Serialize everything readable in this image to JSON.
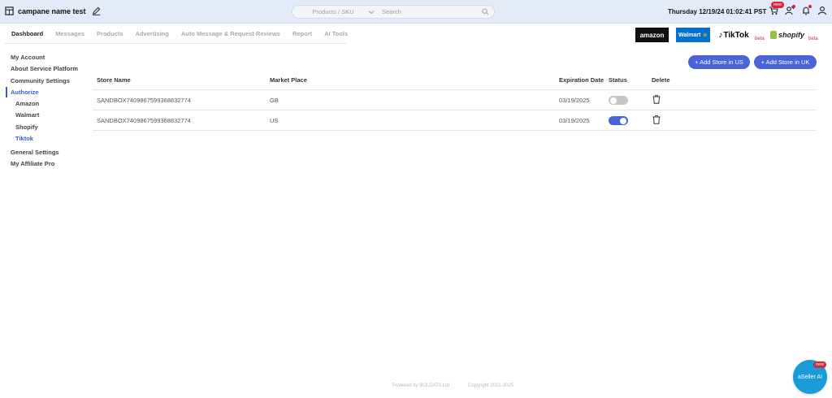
{
  "header": {
    "store_name": "campane name test",
    "search_select": "Products / SKU",
    "search_placeholder": "Search",
    "datetime": "Thursday 12/19/24 01:02:41 PST",
    "new_badge": "new"
  },
  "nav": {
    "tabs": [
      "Dashboard",
      "Messages",
      "Products",
      "Advertising",
      "Auto Message & Request Reviews",
      "Report",
      "AI Tools"
    ],
    "active": "Dashboard"
  },
  "marketplaces": {
    "amazon": "amazon",
    "walmart": "Walmart",
    "tiktok": "TikTok",
    "shopify": "shopify",
    "beta_label": "beta"
  },
  "sidebar": {
    "items": [
      {
        "label": "My Account"
      },
      {
        "label": "About Service Platform"
      },
      {
        "label": "Community Settings"
      },
      {
        "label": "Authorize"
      },
      {
        "label": "Amazon"
      },
      {
        "label": "Walmart"
      },
      {
        "label": "Shopify"
      },
      {
        "label": "Tiktok"
      },
      {
        "label": "General Settings"
      },
      {
        "label": "My Affiliate Pro"
      }
    ]
  },
  "actions": {
    "add_us": "+ Add Store in US",
    "add_uk": "+ Add Store in UK"
  },
  "table": {
    "headers": {
      "store": "Store Name",
      "market": "Market Place",
      "expiration": "Expiration Date",
      "status": "Status",
      "delete": "Delete"
    },
    "rows": [
      {
        "store": "SANDBOX7409867599368832774",
        "market": "GB",
        "expiration": "03/19/2025",
        "status": false
      },
      {
        "store": "SANDBOX7409867599368832774",
        "market": "US",
        "expiration": "03/19/2025",
        "status": true
      }
    ]
  },
  "footer": {
    "powered": "Powered by BOLDATA Ltd",
    "copyright": "Copyright 2021-2025"
  },
  "ai": {
    "label": "aSeller AI",
    "badge": "new"
  },
  "colors": {
    "accent": "#4a64d8",
    "topbar": "#e3ebf8",
    "badge": "#d6253c",
    "ai": "#1b9bd7"
  }
}
